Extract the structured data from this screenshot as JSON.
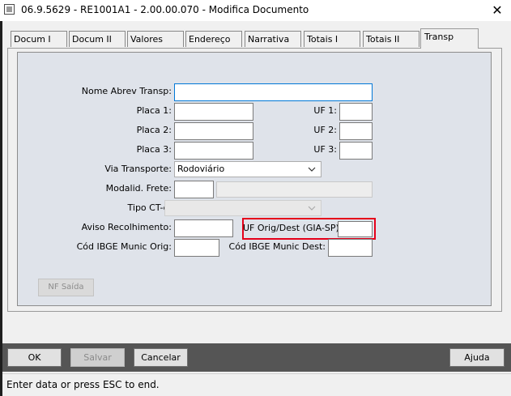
{
  "window": {
    "title": "06.9.5629 - RE1001A1 - 2.00.00.070 - Modifica Documento",
    "close_glyph": "✕"
  },
  "tabs": [
    {
      "label": "Docum I",
      "active": false
    },
    {
      "label": "Docum II",
      "active": false
    },
    {
      "label": "Valores",
      "active": false
    },
    {
      "label": "Endereço",
      "active": false
    },
    {
      "label": "Narrativa",
      "active": false
    },
    {
      "label": "Totais I",
      "active": false
    },
    {
      "label": "Totais II",
      "active": false
    },
    {
      "label": "Transp",
      "active": true
    }
  ],
  "form": {
    "nome_abrev_transp": {
      "label": "Nome Abrev Transp:",
      "value": ""
    },
    "placa1": {
      "label": "Placa 1:",
      "value": ""
    },
    "placa2": {
      "label": "Placa 2:",
      "value": ""
    },
    "placa3": {
      "label": "Placa 3:",
      "value": ""
    },
    "uf1": {
      "label": "UF 1:",
      "value": ""
    },
    "uf2": {
      "label": "UF 2:",
      "value": ""
    },
    "uf3": {
      "label": "UF 3:",
      "value": ""
    },
    "via_transporte": {
      "label": "Via Transporte:",
      "value": "Rodoviário"
    },
    "modalid_frete": {
      "label": "Modalid. Frete:",
      "value": "",
      "desc": ""
    },
    "tipo_cte": {
      "label": "Tipo CT-e:",
      "value": ""
    },
    "aviso_recolhimento": {
      "label": "Aviso Recolhimento:",
      "value": ""
    },
    "uf_orig_dest": {
      "label": "UF Orig/Dest (GIA-SP):",
      "value": ""
    },
    "cod_ibge_orig": {
      "label": "Cód IBGE Munic Orig:",
      "value": ""
    },
    "cod_ibge_dest": {
      "label": "Cód IBGE Munic Dest:",
      "value": ""
    },
    "nf_saida_label": "NF Saída"
  },
  "buttons": {
    "ok": "OK",
    "salvar": "Salvar",
    "cancelar": "Cancelar",
    "ajuda": "Ajuda"
  },
  "status": {
    "text": "Enter data or press ESC to end."
  },
  "colors": {
    "highlight": "#e5001a",
    "focus": "#0078d7",
    "panel": "#dfe3ea",
    "bottom_bar": "#555555"
  }
}
